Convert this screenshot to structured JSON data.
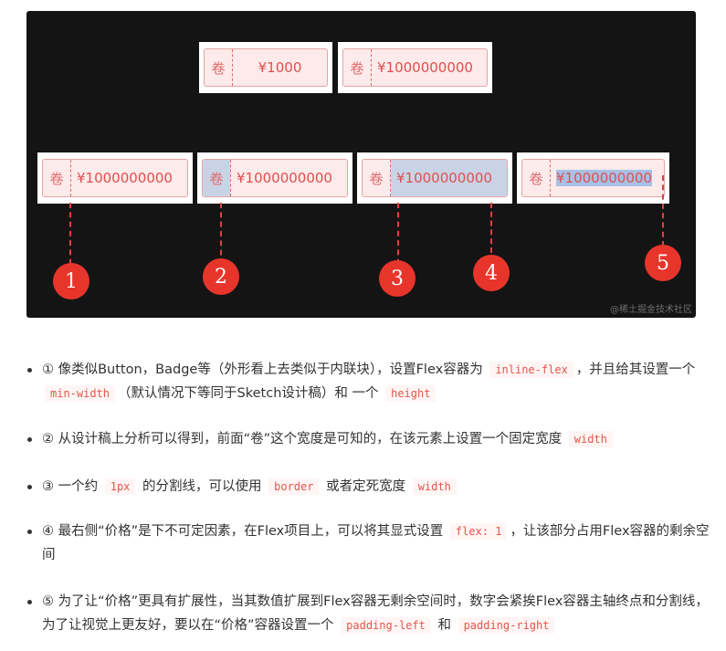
{
  "figure": {
    "coupon_tag": "卷",
    "price_short": "¥1000",
    "price_long": "¥1000000000",
    "markers": [
      "1",
      "2",
      "3",
      "4",
      "5"
    ],
    "watermark": "@稀土掘金技术社区"
  },
  "bullets": [
    {
      "parts": [
        {
          "t": "① 像类似Button，Badge等（外形看上去类似于内联块），设置Flex容器为 "
        },
        {
          "c": "inline-flex"
        },
        {
          "t": "，并且给其设置一个 "
        },
        {
          "c": "min-width"
        },
        {
          "t": "（默认情况下等同于Sketch设计稿）和 一个 "
        },
        {
          "c": "height"
        }
      ]
    },
    {
      "parts": [
        {
          "t": "② 从设计稿上分析可以得到，前面“卷”这个宽度是可知的，在该元素上设置一个固定宽度 "
        },
        {
          "c": "width"
        }
      ]
    },
    {
      "parts": [
        {
          "t": "③ 一个约 "
        },
        {
          "c": "1px"
        },
        {
          "t": " 的分割线，可以使用 "
        },
        {
          "c": "border"
        },
        {
          "t": " 或者定死宽度 "
        },
        {
          "c": "width"
        }
      ]
    },
    {
      "parts": [
        {
          "t": "④ 最右侧“价格”是下不可定因素，在Flex项目上，可以将其显式设置 "
        },
        {
          "c": "flex: 1"
        },
        {
          "t": "，让该部分占用Flex容器的剩余空间"
        }
      ]
    },
    {
      "parts": [
        {
          "t": "⑤ 为了让“价格”更具有扩展性，当其数值扩展到Flex容器无剩余空间时，数字会紧挨Flex容器主轴终点和分割线，为了让视觉上更友好，要以在“价格”容器设置一个 "
        },
        {
          "c": "padding-left"
        },
        {
          "t": " 和 "
        },
        {
          "c": "padding-right"
        }
      ]
    }
  ]
}
